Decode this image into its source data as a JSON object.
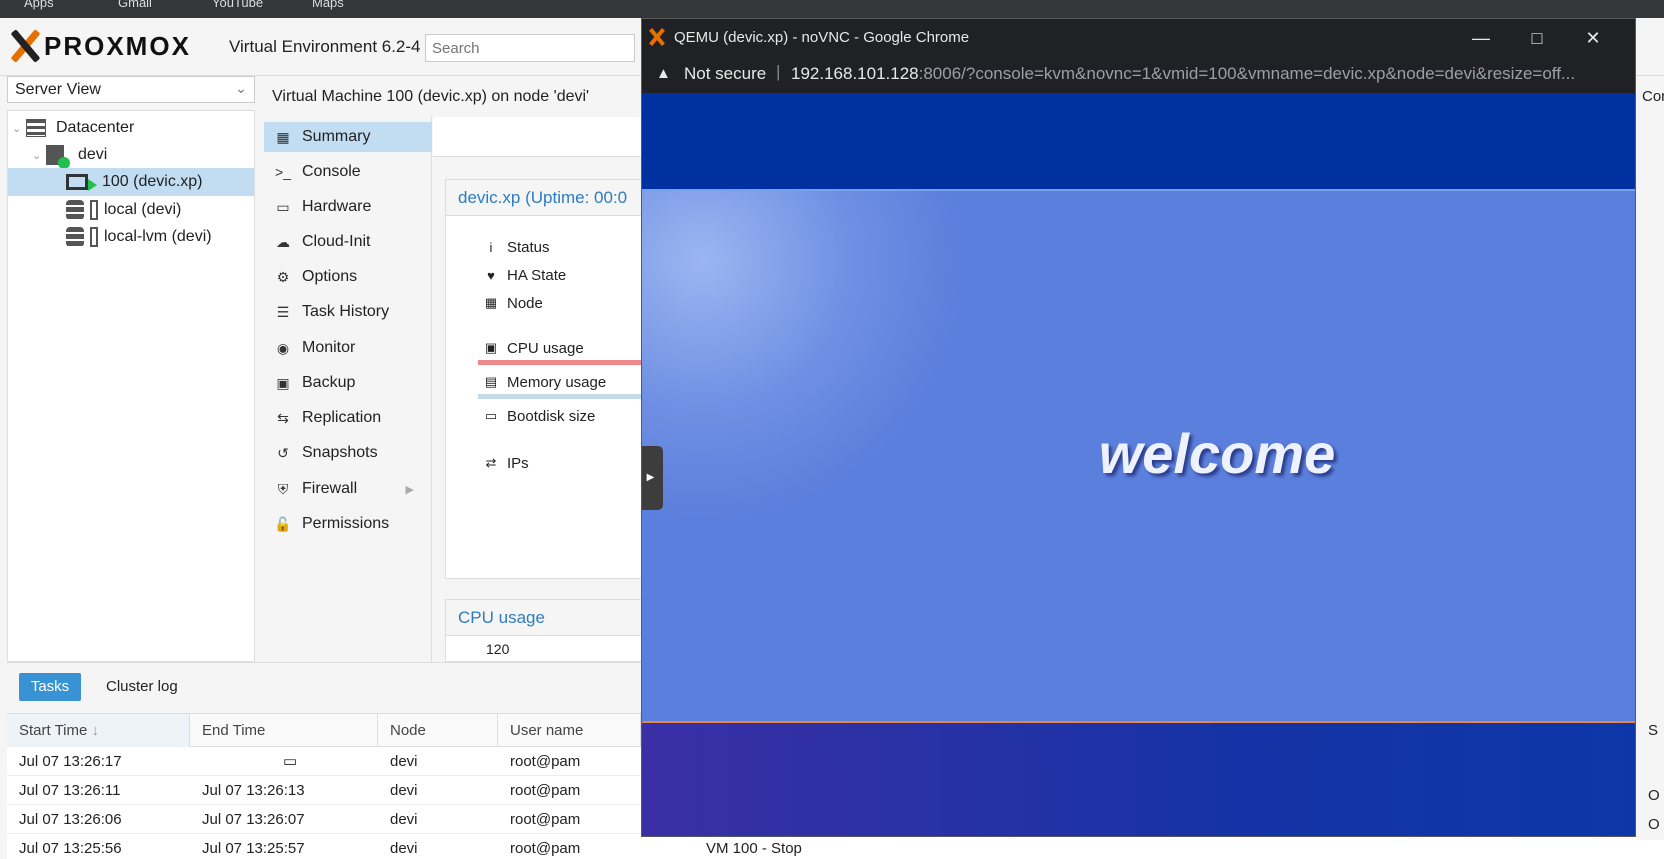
{
  "bookmarks": [
    "Apps",
    "Gmail",
    "YouTube",
    "Maps"
  ],
  "proxmox": {
    "logo": "PROXMOX",
    "version": "Virtual Environment 6.2-4",
    "search_placeholder": "Search",
    "view_select": "Server View"
  },
  "tree": [
    {
      "label": "Datacenter",
      "icon": "datacenter-icon"
    },
    {
      "label": "devi",
      "icon": "node-icon"
    },
    {
      "label": "100 (devic.xp)",
      "icon": "vm-running-icon",
      "selected": true
    },
    {
      "label": "local (devi)",
      "icon": "storage-icon"
    },
    {
      "label": "local-lvm (devi)",
      "icon": "storage-icon"
    }
  ],
  "vm": {
    "title": "Virtual Machine 100 (devic.xp) on node 'devi'",
    "nav": [
      {
        "label": "Summary",
        "icon": "book-icon"
      },
      {
        "label": "Console",
        "icon": "terminal-icon"
      },
      {
        "label": "Hardware",
        "icon": "monitor-icon"
      },
      {
        "label": "Cloud-Init",
        "icon": "cloud-icon"
      },
      {
        "label": "Options",
        "icon": "gear-icon"
      },
      {
        "label": "Task History",
        "icon": "list-icon"
      },
      {
        "label": "Monitor",
        "icon": "eye-icon"
      },
      {
        "label": "Backup",
        "icon": "floppy-icon"
      },
      {
        "label": "Replication",
        "icon": "retweet-icon"
      },
      {
        "label": "Snapshots",
        "icon": "history-icon"
      },
      {
        "label": "Firewall",
        "icon": "shield-icon"
      },
      {
        "label": "Permissions",
        "icon": "unlock-icon"
      }
    ],
    "summary_header": "devic.xp (Uptime: 00:0",
    "summary_rows": [
      "Status",
      "HA State",
      "Node",
      "CPU usage",
      "Memory usage",
      "Bootdisk size",
      "IPs"
    ],
    "cpu_panel_title": "CPU usage",
    "cpu_tick": "120"
  },
  "tasks": {
    "tab_tasks": "Tasks",
    "tab_cluster": "Cluster log",
    "columns": [
      "Start Time",
      "End Time",
      "Node",
      "User name"
    ],
    "rows": [
      {
        "start": "Jul 07 13:26:17",
        "end": "",
        "node": "devi",
        "user": "root@pam",
        "desc": "",
        "status": ""
      },
      {
        "start": "Jul 07 13:26:11",
        "end": "Jul 07 13:26:13",
        "node": "devi",
        "user": "root@pam",
        "desc": "",
        "status": "O"
      },
      {
        "start": "Jul 07 13:26:06",
        "end": "Jul 07 13:26:07",
        "node": "devi",
        "user": "root@pam",
        "desc": "",
        "status": "O"
      },
      {
        "start": "Jul 07 13:25:56",
        "end": "Jul 07 13:25:57",
        "node": "devi",
        "user": "root@pam",
        "desc": "VM 100 - Stop",
        "status": ""
      }
    ]
  },
  "popup": {
    "title": "QEMU (devic.xp) - noVNC - Google Chrome",
    "not_secure": "Not secure",
    "url_host": "192.168.101.128",
    "url_path": ":8006/?console=kvm&novnc=1&vmid=100&vmname=devic.xp&node=devi&resize=off...",
    "welcome": "welcome"
  },
  "edge": {
    "top": "Con",
    "col": "S"
  },
  "colors": {
    "accent": "#3892d4",
    "selected": "#c2ddf2",
    "xp_blue": "#0031a0",
    "proxmox_orange": "#e57000"
  }
}
